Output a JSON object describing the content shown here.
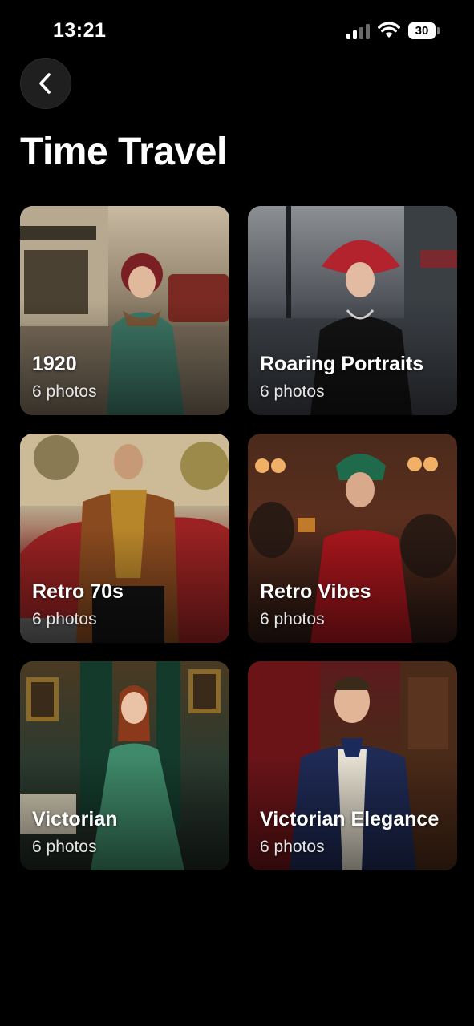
{
  "status_bar": {
    "time": "13:21",
    "battery": "30"
  },
  "header": {
    "title": "Time Travel"
  },
  "albums": [
    {
      "title": "1920",
      "count": "6 photos"
    },
    {
      "title": "Roaring Portraits",
      "count": "6 photos"
    },
    {
      "title": "Retro 70s",
      "count": "6 photos"
    },
    {
      "title": "Retro Vibes",
      "count": "6 photos"
    },
    {
      "title": "Victorian",
      "count": "6 photos"
    },
    {
      "title": "Victorian Elegance",
      "count": "6 photos"
    }
  ]
}
